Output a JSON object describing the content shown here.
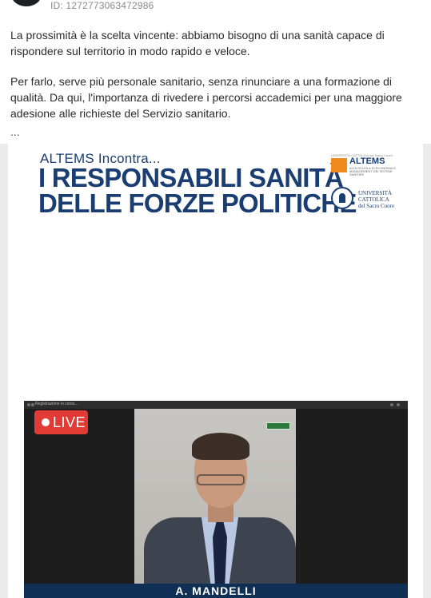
{
  "post": {
    "id_label": "ID: 1272773063472986",
    "paragraphs": [
      "La prossimità è la scelta vincente: abbiamo bisogno di una sanità capace di rispondere sul territorio in modo rapido e veloce.",
      "Per farlo, serve più personale sanitario, senza rinunciare a una formazione di qualità. Da qui, l'importanza di rivedere i percorsi accademici per una maggiore adesione alle richieste del Servizio sanitario."
    ],
    "ellipsis": "..."
  },
  "banner": {
    "subtitle": "ALTEMS Incontra...",
    "title_line1": "I RESPONSABILI SANITÀ",
    "title_line2": "DELLE FORZE POLITICHE"
  },
  "logos": {
    "altems_caption": "UNIVERSITÀ CATTOLICA del Sacro Cuore",
    "altems_name": "ALTEMS",
    "altems_desc": "ALTA SCUOLA DI ECONOMIA E MANAGEMENT DEI SISTEMI SANITARI",
    "ucsc_line1": "UNIVERSITÀ",
    "ucsc_line2": "CATTOLICA",
    "ucsc_line3": "del Sacro Cuore",
    "brand_color": "#1a3d72",
    "accent_color": "#f18a1e"
  },
  "video": {
    "topbar_text": "Registrazione in corso...",
    "live_label": "LIVE",
    "live_color": "#e23b35",
    "speaker_name": "A. MANDELLI",
    "name_bar_color": "#0f2f55"
  }
}
